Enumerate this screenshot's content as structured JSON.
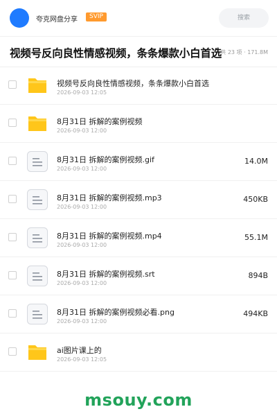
{
  "header": {
    "share_name": "夸克网盘分享",
    "badge": "SVIP",
    "search_placeholder": "搜索"
  },
  "folder": {
    "title": "视频号反向良性情感视频，条条爆款小白首选",
    "meta": "共 23 项 · 171.8M"
  },
  "files": [
    {
      "type": "folder",
      "name": "视频号反向良性情感视频，条条爆款小白首选",
      "date": "2026-09-03 12:05",
      "size": ""
    },
    {
      "type": "folder",
      "name": "8月31日 拆解的案例视频",
      "date": "2026-09-03 12:00",
      "size": ""
    },
    {
      "type": "file",
      "name": "8月31日 拆解的案例视频.gif",
      "date": "2026-09-03 12:00",
      "size": "14.0M"
    },
    {
      "type": "file",
      "name": "8月31日 拆解的案例视频.mp3",
      "date": "2026-09-03 12:00",
      "size": "450KB"
    },
    {
      "type": "file",
      "name": "8月31日 拆解的案例视频.mp4",
      "date": "2026-09-03 12:00",
      "size": "55.1M"
    },
    {
      "type": "file",
      "name": "8月31日 拆解的案例视频.srt",
      "date": "2026-09-03 12:00",
      "size": "894B"
    },
    {
      "type": "file",
      "name": "8月31日 拆解的案例视频必看.png",
      "date": "2026-09-03 12:00",
      "size": "494KB"
    },
    {
      "type": "folder",
      "name": "ai图片课上的",
      "date": "2026-09-03 12:05",
      "size": ""
    }
  ],
  "watermark": "msouy.com",
  "colors": {
    "avatar": "#1f7bff",
    "badge": "#ff9a2e",
    "folder_icon": "#ffc61a",
    "watermark": "#22a35a"
  }
}
